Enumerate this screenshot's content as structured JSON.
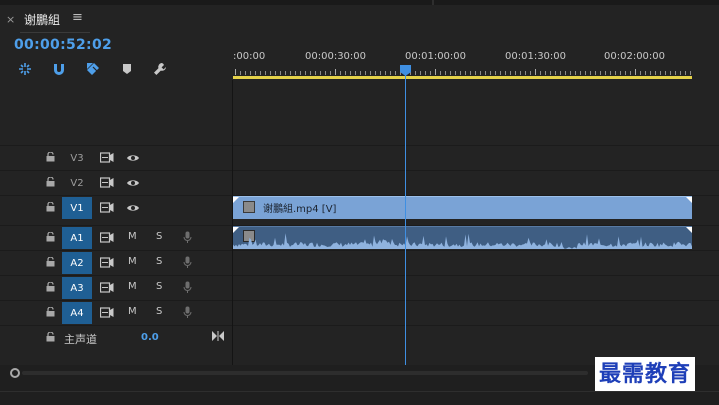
{
  "panel": {
    "close_glyph": "×",
    "title": "谢鵬組",
    "menu_glyph": "≡"
  },
  "timecode": "00:00:52:02",
  "tools": [
    {
      "name": "snap-ripple-icon"
    },
    {
      "name": "magnet-icon"
    },
    {
      "name": "linked-selection-icon"
    },
    {
      "name": "marker-icon"
    },
    {
      "name": "wrench-icon"
    }
  ],
  "ruler": {
    "labels": [
      ":00:00",
      "00:00:30:00",
      "00:01:00:00",
      "00:01:30:00",
      "00:02:00:00"
    ]
  },
  "tracks": {
    "video": [
      {
        "label": "V3",
        "active": false
      },
      {
        "label": "V2",
        "active": false
      },
      {
        "label": "V1",
        "active": true
      }
    ],
    "audio": [
      {
        "label": "A1",
        "active": true,
        "m": "M",
        "s": "S"
      },
      {
        "label": "A2",
        "active": true,
        "m": "M",
        "s": "S"
      },
      {
        "label": "A3",
        "active": true,
        "m": "M",
        "s": "S"
      },
      {
        "label": "A4",
        "active": true,
        "m": "M",
        "s": "S"
      }
    ],
    "master": {
      "label": "主声道",
      "value": "0.0"
    }
  },
  "clips": {
    "video_name": "谢鵬組.mp4 [V]"
  },
  "colors": {
    "accent": "#4e9fea",
    "track_active": "#1f5f94",
    "video_clip": "#7aa3d6",
    "audio_clip": "#3f5e83",
    "work_area": "#e5d24a"
  },
  "watermark": "最需教育"
}
